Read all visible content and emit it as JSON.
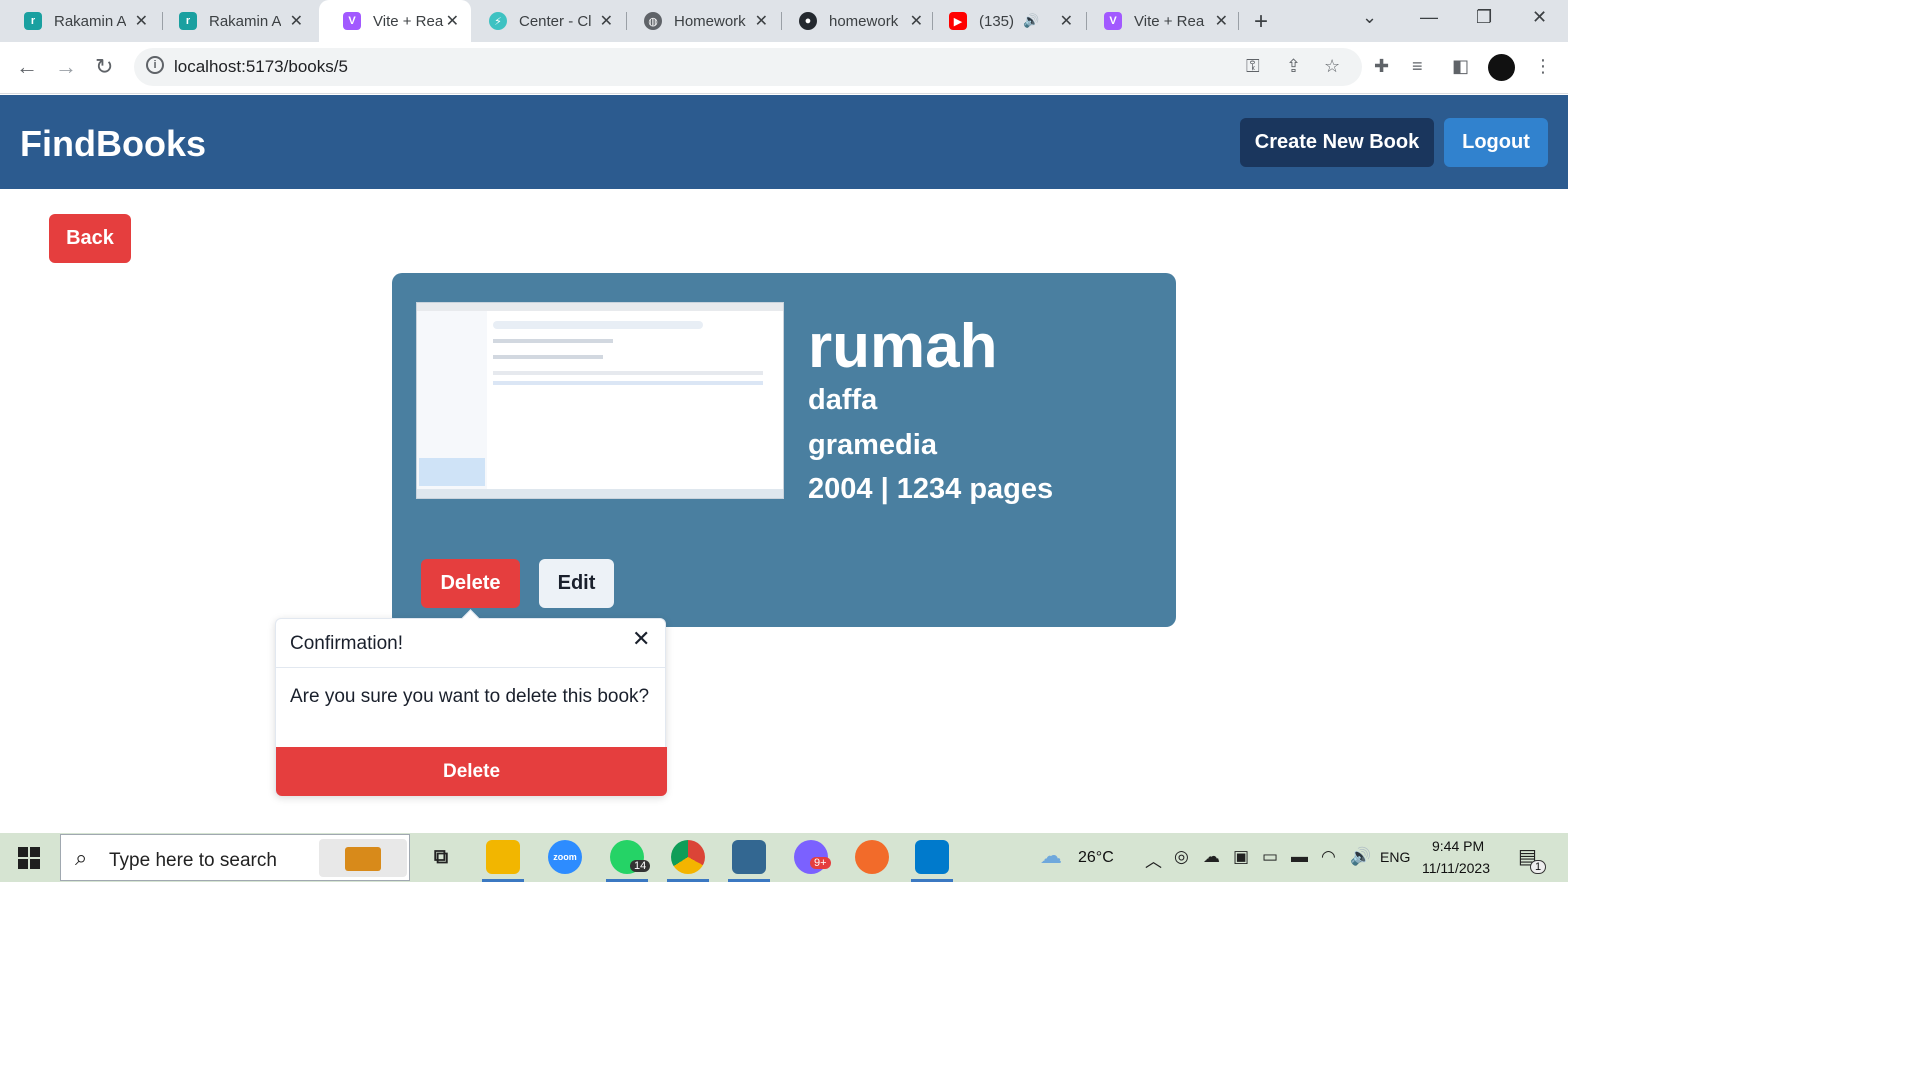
{
  "browser": {
    "tabs": [
      {
        "label": "Rakamin A",
        "icon": "rakamin-icon",
        "color": "#1aa0a0"
      },
      {
        "label": "Rakamin A",
        "icon": "rakamin-icon",
        "color": "#1aa0a0"
      },
      {
        "label": "Vite + Rea",
        "icon": "vite-icon",
        "color": "#a259ff",
        "active": true
      },
      {
        "label": "Center - Cl",
        "icon": "center-icon",
        "color": "#3ec2c2"
      },
      {
        "label": "Homework",
        "icon": "globe-icon",
        "color": "#5f6368"
      },
      {
        "label": "homework",
        "icon": "github-icon",
        "color": "#24292f"
      },
      {
        "label": "(135) (",
        "icon": "youtube-icon",
        "color": "#ff0000"
      },
      {
        "label": "Vite + Rea",
        "icon": "vite-icon",
        "color": "#a259ff"
      }
    ],
    "url": "localhost:5173/books/5"
  },
  "header": {
    "brand": "FindBooks",
    "create_label": "Create New Book",
    "logout_label": "Logout"
  },
  "back_label": "Back",
  "book": {
    "title": "rumah",
    "author": "daffa",
    "publisher": "gramedia",
    "details": "2004 | 1234 pages",
    "delete_label": "Delete",
    "edit_label": "Edit"
  },
  "confirm": {
    "title": "Confirmation!",
    "message": "Are you sure you want to delete this book?",
    "delete_label": "Delete",
    "close_symbol": "✕"
  },
  "taskbar": {
    "search_placeholder": "Type here to search",
    "weather": "26°C",
    "language": "ENG",
    "time": "9:44 PM",
    "date": "11/11/2023",
    "whatsapp_badge": "14",
    "discord_badge": "9+",
    "notif_badge": "1"
  },
  "colors": {
    "header_bg": "#2c5b8f",
    "card_bg": "#4a7fa0",
    "danger": "#e53e3e",
    "primary": "#3182ce",
    "dark": "#1a365d"
  }
}
